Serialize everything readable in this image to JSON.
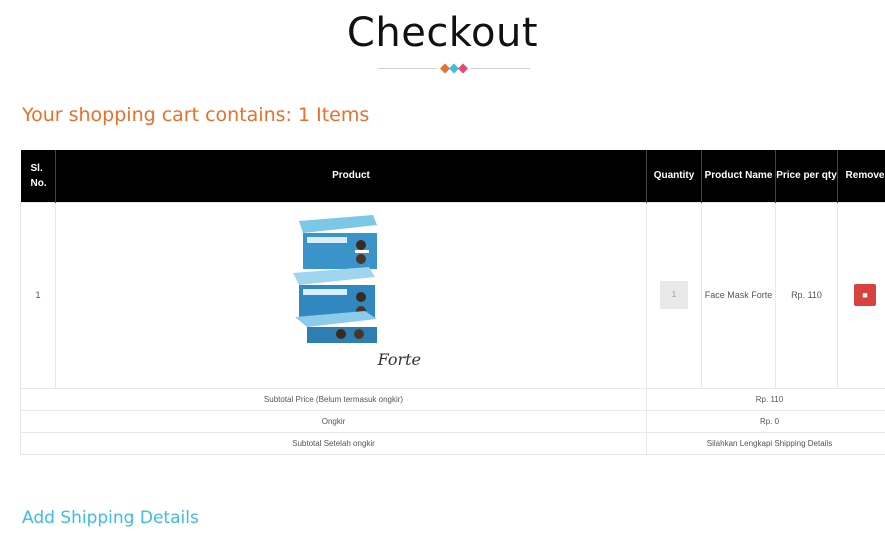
{
  "page": {
    "title": "Checkout"
  },
  "divider": {
    "colors": [
      "#e8702a",
      "#3fbbe4",
      "#e84a6a"
    ]
  },
  "cart": {
    "heading": "Your shopping cart contains: 1 Items",
    "columns": {
      "sl": "Sl. No.",
      "product": "Product",
      "quantity": "Quantity",
      "name": "Product Name",
      "price": "Price per qty",
      "remove": "Remove"
    },
    "rows": [
      {
        "sl": "1",
        "image_icon": "face-mask-box-image",
        "image_brand": "Forte",
        "quantity": "1",
        "name": "Face Mask Forte",
        "price": "Rp. 110",
        "remove_icon": "trash-icon",
        "remove_symbol": "■"
      }
    ],
    "summary": [
      {
        "label": "Subtotal Price (Belum termasuk ongkir)",
        "value": "Rp. 110"
      },
      {
        "label": "Ongkir",
        "value": "Rp. 0"
      },
      {
        "label": "Subtotal Setelah ongkir",
        "value": "Silahkan Lengkapi Shipping Details"
      }
    ]
  },
  "shipping": {
    "link": "Add Shipping Details"
  },
  "colors": {
    "accent_orange": "#e8702a",
    "accent_blue": "#3fbbe4",
    "remove_red": "#d9413f",
    "header_bg": "#000000"
  }
}
